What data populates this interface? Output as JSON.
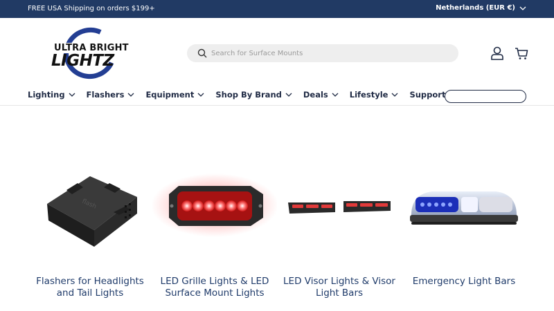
{
  "announcement": {
    "shipping_text": "FREE USA Shipping on orders $199+",
    "locale_label": "Netherlands (EUR €)"
  },
  "logo": {
    "line1": "ULTRA BRIGHT",
    "line2": "LIGHTZ",
    "brand_color": "#233e93"
  },
  "search": {
    "placeholder": "Search for Surface Mounts"
  },
  "nav": {
    "items": [
      "Lighting",
      "Flashers",
      "Equipment",
      "Shop By Brand",
      "Deals",
      "Lifestyle",
      "Support"
    ]
  },
  "products": [
    {
      "title": "Flashers for Headlights and Tail Lights",
      "icon": "flasher-module-image"
    },
    {
      "title": "LED Grille Lights & LED Surface Mount Lights",
      "icon": "grille-light-image"
    },
    {
      "title": "LED Visor Lights & Visor Light Bars",
      "icon": "visor-light-image"
    },
    {
      "title": "Emergency Light Bars",
      "icon": "emergency-light-bar-image"
    }
  ],
  "colors": {
    "announcement_bg": "#213a64",
    "text": "#1f2a44",
    "product_title": "#1f3b6a"
  }
}
